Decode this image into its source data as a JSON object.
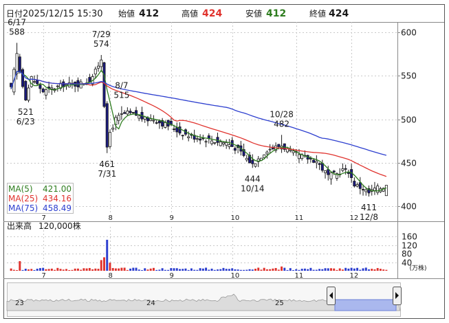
{
  "header": {
    "date_label": "日付",
    "datetime": "2025/12/15 15:30",
    "open_label": "始値",
    "open": "412",
    "high_label": "高値",
    "high": "424",
    "low_label": "安値",
    "low": "412",
    "close_label": "終値",
    "close": "424"
  },
  "legend": [
    {
      "label": "MA(5)",
      "value": "421.00",
      "color": "#2e7d1f"
    },
    {
      "label": "MA(25)",
      "value": "434.16",
      "color": "#e0332e"
    },
    {
      "label": "MA(75)",
      "value": "458.49",
      "color": "#2d3fcf"
    }
  ],
  "volume_label": "出来高",
  "volume_unit_label": "120,000株",
  "volume_axis_unit": "(万株)",
  "colors": {
    "up": "#ffffff",
    "down": "#1a1a80",
    "candle_outline": "#1a1a1a",
    "volume_up": "#e0332e",
    "volume_down": "#2d3fcf",
    "grid": "#c8c8c8",
    "header_open": "#1a1a1a",
    "header_high": "#e0332e",
    "header_low": "#2e7d1f",
    "header_close": "#1a1a1a",
    "navigator_fill": "#aab8ee"
  },
  "chart_data": {
    "type": "candlestick",
    "price_axis": {
      "ticks": [
        400,
        450,
        500,
        550,
        600
      ],
      "range": [
        392,
        612
      ]
    },
    "volume_axis": {
      "ticks": [
        40,
        80,
        120,
        160
      ],
      "range": [
        0,
        180
      ]
    },
    "month_ticks": [
      {
        "label": "7",
        "day_index": 11
      },
      {
        "label": "8",
        "day_index": 34
      },
      {
        "label": "9",
        "day_index": 55
      },
      {
        "label": "10",
        "day_index": 76
      },
      {
        "label": "11",
        "day_index": 98
      },
      {
        "label": "12",
        "day_index": 117
      }
    ],
    "annotations": [
      {
        "date": "6/17",
        "value": "588",
        "kind": "high",
        "day_index": 2
      },
      {
        "date": "6/23",
        "value": "521",
        "kind": "low",
        "day_index": 5
      },
      {
        "date": "7/29",
        "value": "574",
        "kind": "high",
        "day_index": 31
      },
      {
        "date": "7/31",
        "value": "461",
        "kind": "low",
        "day_index": 33
      },
      {
        "date": "8/7",
        "value": "515",
        "kind": "high",
        "day_index": 38
      },
      {
        "date": "10/14",
        "value": "444",
        "kind": "low",
        "day_index": 83
      },
      {
        "date": "10/28",
        "value": "482",
        "kind": "high",
        "day_index": 93
      },
      {
        "date": "12/8",
        "value": "411",
        "kind": "low",
        "day_index": 123
      }
    ],
    "ohlc_control_points": [
      [
        0,
        535
      ],
      [
        2,
        575
      ],
      [
        3,
        555
      ],
      [
        5,
        525
      ],
      [
        7,
        548
      ],
      [
        9,
        540
      ],
      [
        11,
        532
      ],
      [
        14,
        535
      ],
      [
        18,
        540
      ],
      [
        23,
        540
      ],
      [
        27,
        545
      ],
      [
        29,
        555
      ],
      [
        31,
        570
      ],
      [
        33,
        465
      ],
      [
        34,
        485
      ],
      [
        36,
        500
      ],
      [
        38,
        505
      ],
      [
        40,
        507
      ],
      [
        43,
        505
      ],
      [
        46,
        500
      ],
      [
        49,
        500
      ],
      [
        52,
        495
      ],
      [
        55,
        492
      ],
      [
        58,
        485
      ],
      [
        62,
        480
      ],
      [
        66,
        478
      ],
      [
        70,
        475
      ],
      [
        74,
        473
      ],
      [
        78,
        465
      ],
      [
        80,
        458
      ],
      [
        83,
        448
      ],
      [
        86,
        458
      ],
      [
        88,
        465
      ],
      [
        91,
        468
      ],
      [
        93,
        470
      ],
      [
        96,
        462
      ],
      [
        99,
        458
      ],
      [
        102,
        455
      ],
      [
        105,
        452
      ],
      [
        107,
        443
      ],
      [
        109,
        435
      ],
      [
        112,
        437
      ],
      [
        114,
        442
      ],
      [
        116,
        440
      ],
      [
        118,
        425
      ],
      [
        121,
        420
      ],
      [
        123,
        415
      ],
      [
        125,
        420
      ],
      [
        127,
        421
      ],
      [
        129,
        424
      ]
    ],
    "last_day_index": 129,
    "volume_spikes": [
      {
        "day_index": 3,
        "value": 45,
        "direction": "up"
      },
      {
        "day_index": 31,
        "value": 50,
        "direction": "up"
      },
      {
        "day_index": 32,
        "value": 63,
        "direction": "up"
      },
      {
        "day_index": 33,
        "value": 145,
        "direction": "down"
      },
      {
        "day_index": 34,
        "value": 38,
        "direction": "up"
      },
      {
        "day_index": 93,
        "value": 20,
        "direction": "up"
      }
    ],
    "ma_last": {
      "MA(5)": 421.0,
      "MA(25)": 434.16,
      "MA(75)": 458.49
    },
    "navigator_year_labels": [
      "23",
      "24",
      "25"
    ]
  }
}
